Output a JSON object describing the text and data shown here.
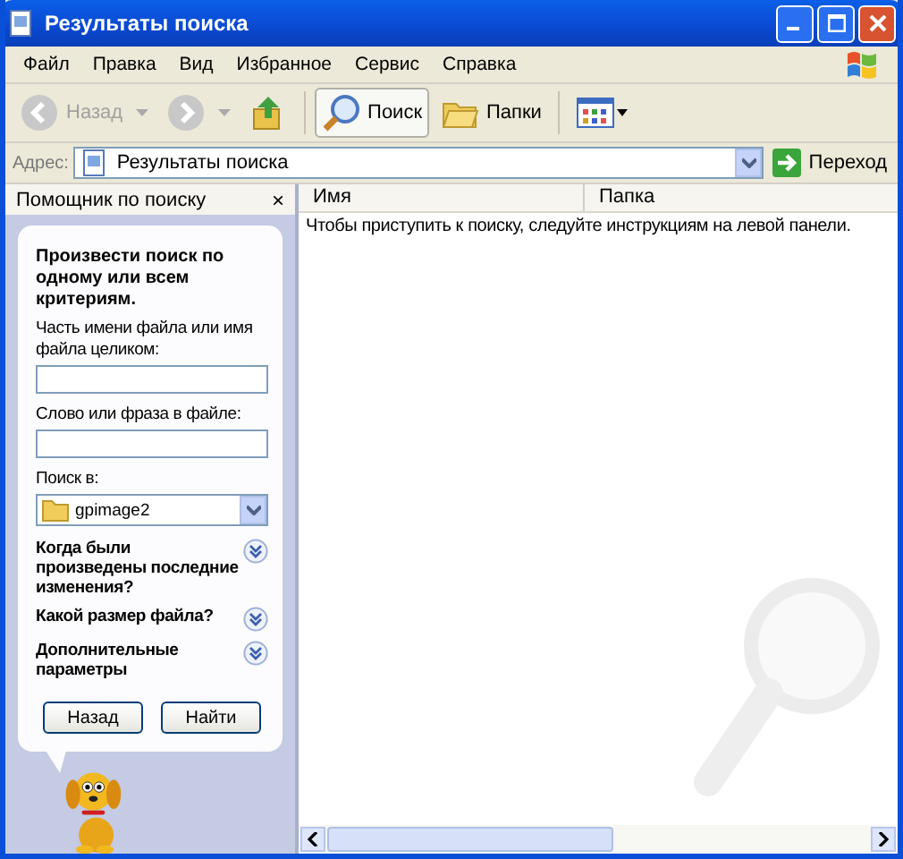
{
  "window": {
    "title": "Результаты поиска"
  },
  "menu": [
    "Файл",
    "Правка",
    "Вид",
    "Избранное",
    "Сервис",
    "Справка"
  ],
  "toolbar": [
    {
      "kind": "back",
      "label": "Назад",
      "disabled": true
    },
    {
      "kind": "forward",
      "disabled": true
    },
    {
      "kind": "up"
    },
    {
      "kind": "search",
      "label": "Поиск",
      "pressed": true
    },
    {
      "kind": "folders",
      "label": "Папки",
      "pressed": false
    },
    {
      "kind": "views"
    }
  ],
  "address": {
    "label": "Адрес:",
    "value": "Результаты поиска",
    "go": "Переход"
  },
  "search_pane": {
    "title": "Помощник по поиску",
    "close": "×",
    "heading": "Произвести поиск по одному или всем критериям.",
    "fields": [
      {
        "label": "Часть имени файла или имя файла целиком:"
      },
      {
        "label": "Слово или фраза в файле:"
      }
    ],
    "look_in": {
      "label": "Поиск в:",
      "value": "gpimage2"
    },
    "sections": [
      {
        "label": "Когда были произведены последние изменения?",
        "expanded": false
      },
      {
        "label": "Какой размер файла?",
        "expanded": false
      },
      {
        "label": "Дополнительные параметры",
        "expanded": false
      }
    ],
    "buttons": [
      "Назад",
      "Найти"
    ]
  },
  "results": {
    "columns": [
      "Имя",
      "Папка"
    ],
    "message": "Чтобы приступить к поиску, следуйте инструкциям на левой панели."
  }
}
